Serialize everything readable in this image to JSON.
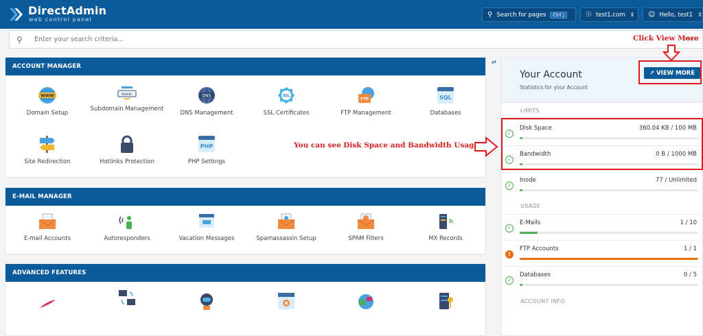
{
  "header": {
    "logo_title": "DirectAdmin",
    "logo_subtitle": "web control panel",
    "search_pages": "Search for pages",
    "search_shortcut": "Ctrl J",
    "domain": "test1.com",
    "user": "Hello, test1"
  },
  "search": {
    "placeholder": "Enter your search criteria...",
    "menu_label": "Menu"
  },
  "account_manager": {
    "title": "ACCOUNT MANAGER",
    "items": [
      {
        "label": "Domain Setup",
        "icon": "www-globe-icon"
      },
      {
        "label": "Subdomain Management",
        "icon": "www-bar-icon"
      },
      {
        "label": "DNS Management",
        "icon": "dns-globe-icon"
      },
      {
        "label": "SSL Certificates",
        "icon": "ssl-badge-icon"
      },
      {
        "label": "FTP Management",
        "icon": "ftp-folder-icon"
      },
      {
        "label": "Databases",
        "icon": "sql-icon"
      },
      {
        "label": "Site Redirection",
        "icon": "signpost-icon"
      },
      {
        "label": "Hotlinks Protection",
        "icon": "padlock-icon"
      },
      {
        "label": "PHP Settings",
        "icon": "php-window-icon"
      }
    ]
  },
  "email_manager": {
    "title": "E-MAIL MANAGER",
    "items": [
      {
        "label": "E-mail Accounts",
        "icon": "envelope-icon"
      },
      {
        "label": "Autoresponders",
        "icon": "broadcast-person-icon"
      },
      {
        "label": "Vacation Messages",
        "icon": "chat-window-icon"
      },
      {
        "label": "Spamassassin Setup",
        "icon": "envelope-gear-icon"
      },
      {
        "label": "SPAM Filters",
        "icon": "envelope-filter-icon"
      },
      {
        "label": "MX Records",
        "icon": "server-wifi-icon"
      }
    ]
  },
  "advanced_features": {
    "title": "ADVANCED FEATURES",
    "items": [
      {
        "icon": "apache-feather-icon"
      },
      {
        "icon": "monitor-sync-icon"
      },
      {
        "icon": "robot-icon"
      },
      {
        "icon": "window-x-icon"
      },
      {
        "icon": "puzzle-globe-icon"
      },
      {
        "icon": "server-key-icon"
      }
    ]
  },
  "account": {
    "title": "Your Account",
    "subtitle": "Statistics for your Account",
    "view_more": "VIEW MORE",
    "limits_label": "LIMITS",
    "usage_label": "USAGE",
    "info_label": "ACCOUNT INFO",
    "limits": [
      {
        "name": "Disk Space",
        "value": "360.04 KB / 100 MB",
        "fraction": 0.004,
        "status": "ok"
      },
      {
        "name": "Bandwidth",
        "value": "0 B / 1000 MB",
        "fraction": 0.0,
        "status": "ok"
      },
      {
        "name": "Inode",
        "value": "77 / Unlimited",
        "fraction": 0.0,
        "status": "ok"
      }
    ],
    "usage": [
      {
        "name": "E-Mails",
        "value": "1 / 10",
        "fraction": 0.1,
        "status": "ok"
      },
      {
        "name": "FTP Accounts",
        "value": "1 / 1",
        "fraction": 1.0,
        "status": "warn"
      },
      {
        "name": "Databases",
        "value": "0 / 5",
        "fraction": 0.0,
        "status": "ok"
      }
    ]
  },
  "annotations": {
    "view_more_note": "Click View More",
    "usage_note": "You can see Disk Space and Bandwidth Usage"
  },
  "colors": {
    "brand": "#0b5a9a",
    "ok": "#4caf50",
    "warn": "#e8700e",
    "annotation": "#e0191f"
  }
}
